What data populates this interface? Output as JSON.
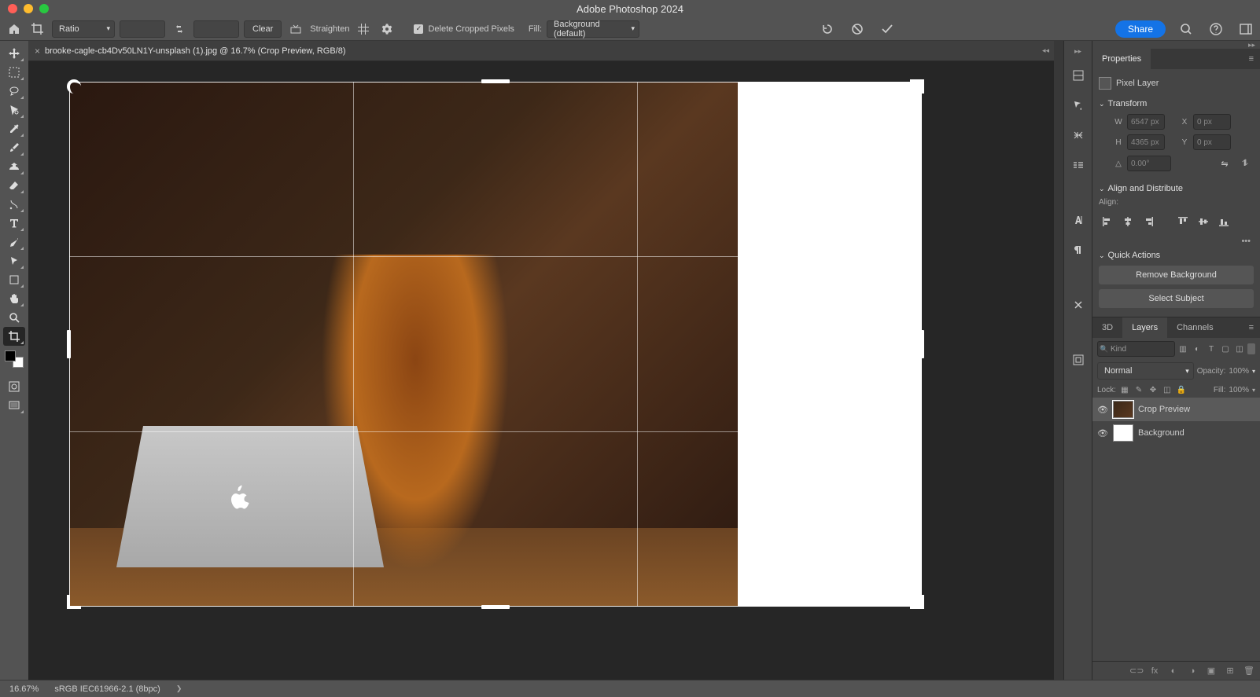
{
  "app_title": "Adobe Photoshop 2024",
  "optionsbar": {
    "ratio_label": "Ratio",
    "width_val": "",
    "height_val": "",
    "clear_label": "Clear",
    "straighten_label": "Straighten",
    "delete_cropped_label": "Delete Cropped Pixels",
    "fill_label": "Fill:",
    "fill_dropdown": "Background (default)",
    "share_label": "Share"
  },
  "document": {
    "tab_title": "brooke-cagle-cb4Dv50LN1Y-unsplash (1).jpg @ 16.7% (Crop Preview, RGB/8)"
  },
  "properties": {
    "panel_title": "Properties",
    "pixel_layer_label": "Pixel Layer",
    "transform_label": "Transform",
    "W": "6547 px",
    "H": "4365 px",
    "X": "0 px",
    "Y": "0 px",
    "angle": "0.00°",
    "align_label": "Align and Distribute",
    "align_sub": "Align:",
    "quick_actions_label": "Quick Actions",
    "remove_bg_label": "Remove Background",
    "select_subject_label": "Select Subject"
  },
  "layers": {
    "tab_3d": "3D",
    "tab_layers": "Layers",
    "tab_channels": "Channels",
    "kind_placeholder": "Kind",
    "blend_mode": "Normal",
    "opacity_label": "Opacity:",
    "opacity_val": "100%",
    "lock_label": "Lock:",
    "fill_label": "Fill:",
    "fill_val": "100%",
    "items": [
      {
        "name": "Crop Preview"
      },
      {
        "name": "Background"
      }
    ]
  },
  "statusbar": {
    "zoom": "16.67%",
    "profile": "sRGB IEC61966-2.1 (8bpc)"
  }
}
